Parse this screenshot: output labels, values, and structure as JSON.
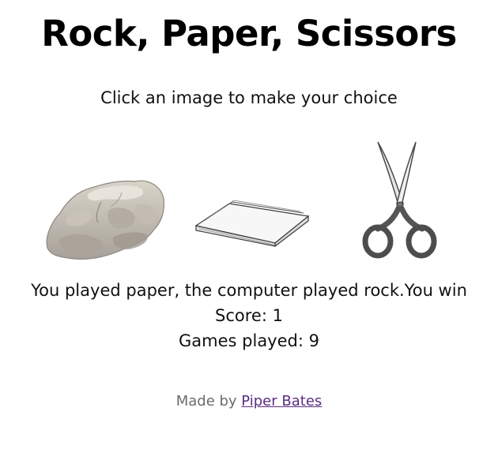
{
  "title": "Rock, Paper, Scissors",
  "instructions": "Click an image to make your choice",
  "choices": {
    "rock": "rock",
    "paper": "paper",
    "scissors": "scissors"
  },
  "result": {
    "message": "You played paper, the computer played rock.You win",
    "score": "Score: 1",
    "games_played": "Games played: 9"
  },
  "footer": {
    "prefix": "Made by ",
    "author": "Piper Bates"
  }
}
